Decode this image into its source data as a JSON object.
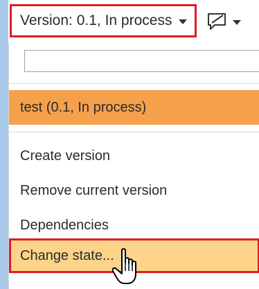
{
  "toolbar": {
    "version_label": "Version: 0.1, In process",
    "comment_icon": "comment-icon",
    "dropdown_icon": "chevron-down-icon"
  },
  "dropdown": {
    "search": {
      "value": "",
      "placeholder": ""
    },
    "current_version": "test (0.1, In process)",
    "items": [
      {
        "label": "Create version"
      },
      {
        "label": "Remove current version"
      },
      {
        "label": "Dependencies"
      },
      {
        "label": "Change state..."
      }
    ]
  },
  "colors": {
    "highlight": "#f5a04a",
    "hover": "#fbd48a",
    "annotation_red": "#e01b24",
    "window_edge": "#a8c8e8"
  },
  "cursor_icon": "hand-pointer-icon"
}
